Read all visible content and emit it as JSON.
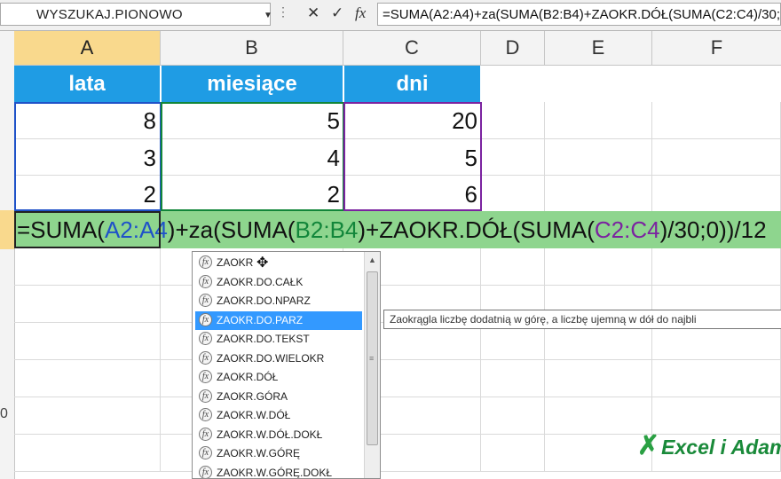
{
  "formula_bar": {
    "name_box": "WYSZUKAJ.PIONOWO",
    "cancel_icon": "✕",
    "enter_icon": "✓",
    "fx_label": "fx",
    "formula": "=SUMA(A2:A4)+za(SUMA(B2:B4)+ZAOKR.DÓŁ(SUMA(C2:C4)/30;0))/12"
  },
  "columns": [
    "A",
    "B",
    "C",
    "D",
    "E",
    "F"
  ],
  "row_numbers_visible": [
    "0"
  ],
  "table": {
    "headers": [
      "lata",
      "miesiące",
      "dni"
    ],
    "rows": [
      [
        "8",
        "5",
        "20"
      ],
      [
        "3",
        "4",
        "5"
      ],
      [
        "2",
        "2",
        "6"
      ]
    ]
  },
  "formula_cell": {
    "p1": "=SUMA(",
    "r1": "A2:A4",
    "p2": ")+za",
    "p3": "(SUMA(",
    "r2": "B2:B4",
    "p4": ")+ZAOKR.DÓŁ(SUMA(",
    "r3": "C2:C4",
    "p5": ")/30;0))/12"
  },
  "autocomplete": {
    "items": [
      "ZAOKR",
      "ZAOKR.DO.CAŁK",
      "ZAOKR.DO.NPARZ",
      "ZAOKR.DO.PARZ",
      "ZAOKR.DO.TEKST",
      "ZAOKR.DO.WIELOKR",
      "ZAOKR.DÓŁ",
      "ZAOKR.GÓRA",
      "ZAOKR.W.DÓŁ",
      "ZAOKR.W.DÓŁ.DOKŁ",
      "ZAOKR.W.GÓRĘ",
      "ZAOKR.W.GÓRĘ.DOKŁ"
    ],
    "selected": "ZAOKR.DO.PARZ",
    "tooltip": "Zaokrągla liczbę dodatnią w górę, a liczbę ujemną w dół do najbli"
  },
  "watermark": "Excel i Adam",
  "colors": {
    "header_fill": "#1f9ce4",
    "formula_row_fill": "#8ed58e",
    "ref_a": "#1f52c8",
    "ref_b": "#12863a",
    "ref_c": "#7b23a0",
    "selected_header": "#f9d98d"
  }
}
